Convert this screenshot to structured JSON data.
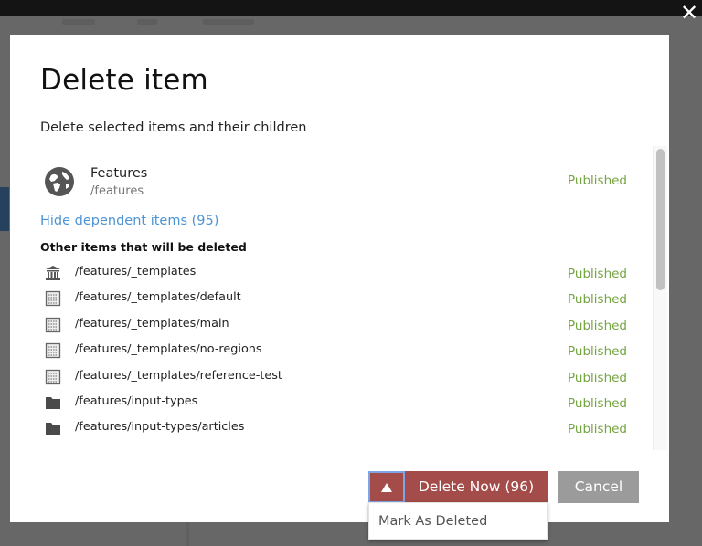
{
  "window": {
    "close_icon": "close-x-icon"
  },
  "dialog": {
    "title": "Delete item",
    "subtitle": "Delete selected items and their children",
    "root_item": {
      "icon": "globe-icon",
      "name": "Features",
      "path": "/features",
      "status": "Published"
    },
    "dependent_link": "Hide dependent items (95)",
    "section_heading": "Other items that will be deleted",
    "items": [
      {
        "icon": "bank-icon",
        "path": "/features/_templates",
        "status": "Published"
      },
      {
        "icon": "template-icon",
        "path": "/features/_templates/default",
        "status": "Published"
      },
      {
        "icon": "template-icon",
        "path": "/features/_templates/main",
        "status": "Published"
      },
      {
        "icon": "template-icon",
        "path": "/features/_templates/no-regions",
        "status": "Published"
      },
      {
        "icon": "template-icon",
        "path": "/features/_templates/reference-test",
        "status": "Published"
      },
      {
        "icon": "folder-icon",
        "path": "/features/input-types",
        "status": "Published"
      },
      {
        "icon": "folder-icon",
        "path": "/features/input-types/articles",
        "status": "Published"
      }
    ],
    "scrollbar_position": 0,
    "buttons": {
      "toggle_icon": "caret-up-icon",
      "delete_now": "Delete Now (96)",
      "cancel": "Cancel"
    },
    "dropdown": {
      "options": [
        "Mark As Deleted"
      ]
    }
  },
  "colors": {
    "status_published": "#74a541",
    "link": "#4c93d6",
    "danger": "#a34c4a",
    "cancel": "#9b9b9b"
  }
}
